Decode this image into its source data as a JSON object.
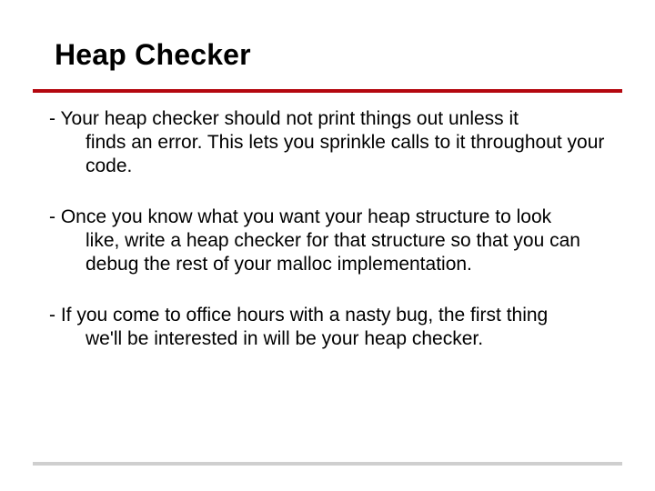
{
  "title": "Heap Checker",
  "bullets": [
    {
      "first": "- Your heap checker should not print things out unless it",
      "rest": "finds an error. This lets you sprinkle calls to it throughout your code."
    },
    {
      "first": "- Once you know what you want your heap structure to look",
      "rest": "like, write a heap checker for that structure so that you can debug the rest of your malloc implementation."
    },
    {
      "first": "- If you come to office hours with a nasty bug, the first thing",
      "rest": "we'll be interested in will be your heap checker."
    }
  ]
}
